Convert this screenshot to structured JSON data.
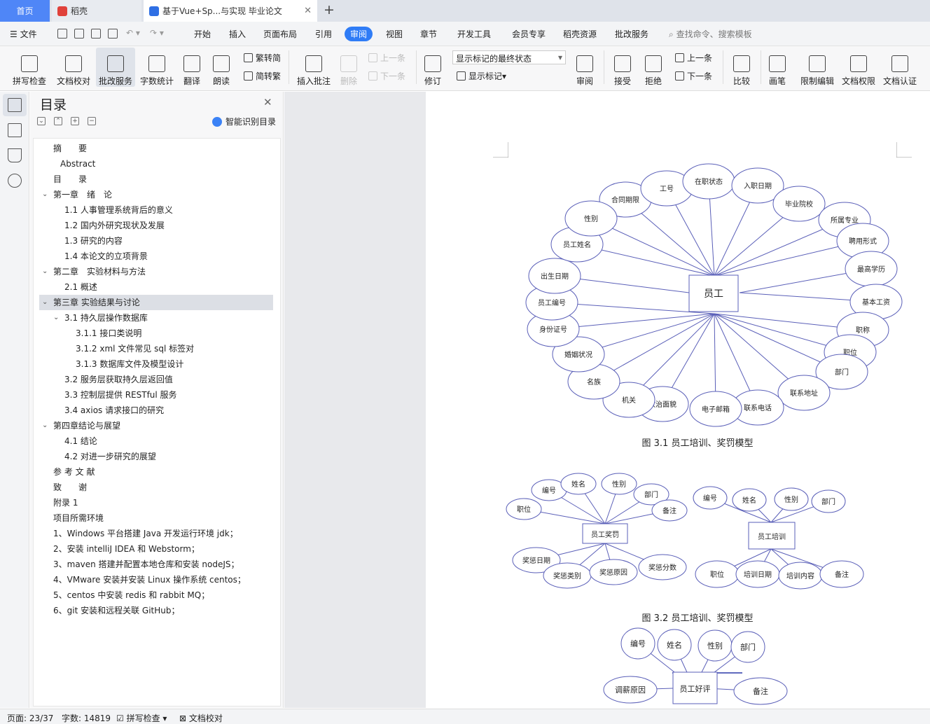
{
  "tabs": {
    "home": "首页",
    "daoke": "稻壳",
    "doc": "基于Vue+Sp...与实现 毕业论文"
  },
  "menu": {
    "file": "文件",
    "items": [
      "开始",
      "插入",
      "页面布局",
      "引用",
      "审阅",
      "视图",
      "章节",
      "开发工具",
      "会员专享",
      "稻壳资源",
      "批改服务"
    ],
    "active": "审阅",
    "search": "查找命令、搜索模板"
  },
  "ribbon": {
    "spell": "拼写检查",
    "proof": "文档校对",
    "review_service": "批改服务",
    "wordcount": "字数统计",
    "translate": "翻译",
    "read": "朗读",
    "to_simplified": "繁转简",
    "to_traditional": "简转繁",
    "insert_comment": "插入批注",
    "delete": "删除",
    "prev_comment": "上一条",
    "next_comment": "下一条",
    "track": "修订",
    "markup_select": "显示标记的最终状态",
    "show_markup": "显示标记",
    "review": "审阅",
    "accept": "接受",
    "reject": "拒绝",
    "prev_change": "上一条",
    "next_change": "下一条",
    "compare": "比较",
    "pen": "画笔",
    "restrict": "限制编辑",
    "perm": "文档权限",
    "cert": "文档认证"
  },
  "toc": {
    "title": "目录",
    "smart": "智能识别目录",
    "items": [
      {
        "text": "摘　　要",
        "level": 1
      },
      {
        "text": "Abstract",
        "level": 1
      },
      {
        "text": "目　　录",
        "level": 1
      },
      {
        "text": "第一章　绪　论",
        "level": 0
      },
      {
        "text": "1.1  人事管理系统背后的意义",
        "level": 2
      },
      {
        "text": "1.2  国内外研究现状及发展",
        "level": 2
      },
      {
        "text": "1.3  研究的内容",
        "level": 2
      },
      {
        "text": "1.4  本论文的立项背景",
        "level": 2
      },
      {
        "text": "第二章　实验材料与方法",
        "level": 0
      },
      {
        "text": "2.1  概述",
        "level": 2
      },
      {
        "text": "第三章  实验结果与讨论",
        "level": 0
      },
      {
        "text": "3.1  持久层操作数据库",
        "level": 2
      },
      {
        "text": "3.1.1  接口类说明",
        "level": 3
      },
      {
        "text": "3.1.2    xml 文件常见 sql 标签对",
        "level": 3
      },
      {
        "text": "3.1.3    数据库文件及模型设计",
        "level": 3
      },
      {
        "text": "3.2  服务层获取持久层返回值",
        "level": 2
      },
      {
        "text": "3.3  控制层提供 RESTful 服务",
        "level": 2
      },
      {
        "text": "3.4 axios 请求接口的研究",
        "level": 2
      },
      {
        "text": "第四章结论与展望",
        "level": 0
      },
      {
        "text": "4.1  结论",
        "level": 2
      },
      {
        "text": "4.2  对进一步研究的展望",
        "level": 2
      },
      {
        "text": "参 考 文 献",
        "level": 1
      },
      {
        "text": "致　　谢",
        "level": 1
      },
      {
        "text": "附录 1",
        "level": 1
      },
      {
        "text": "项目所需环境",
        "level": 1
      },
      {
        "text": "1、Windows 平台搭建 Java 开发运行环境 jdk；",
        "level": 1
      },
      {
        "text": "2、安装 intelliJ IDEA 和 Webstorm；",
        "level": 1
      },
      {
        "text": "3、maven 搭建并配置本地仓库和安装 nodeJS；",
        "level": 1
      },
      {
        "text": "4、VMware 安装并安装 Linux 操作系统 centos；",
        "level": 1
      },
      {
        "text": "5、centos 中安装 redis 和 rabbit MQ；",
        "level": 1
      },
      {
        "text": "6、git 安装和远程关联 GitHub；",
        "level": 1
      }
    ]
  },
  "doc": {
    "fig1": {
      "center": "员工",
      "caption": "图 3.1   员工培训、奖罚模型",
      "attrs": [
        "合同期限",
        "工号",
        "在职状态",
        "入职日期",
        "毕业院校",
        "所属专业",
        "聘用形式",
        "最高学历",
        "基本工资",
        "职称",
        "职位",
        "部门",
        "联系地址",
        "联系电话",
        "电子邮箱",
        "政治面貌",
        "机关",
        "名族",
        "婚姻状况",
        "身份证号",
        "员工编号",
        "出生日期",
        "员工姓名",
        "性别"
      ]
    },
    "fig2": {
      "caption": "图 3.2   员工培训、奖罚模型",
      "left": {
        "center": "员工奖罚",
        "attrs": [
          "编号",
          "姓名",
          "性别",
          "部门",
          "备注",
          "职位",
          "奖惩日期",
          "奖惩类别",
          "奖惩原因",
          "奖惩分数"
        ]
      },
      "right": {
        "center": "员工培训",
        "attrs": [
          "编号",
          "姓名",
          "性别",
          "部门",
          "职位",
          "培训日期",
          "培训内容",
          "备注"
        ]
      }
    },
    "fig3": {
      "center": "员工好评",
      "attrs": [
        "编号",
        "姓名",
        "性别",
        "部门",
        "调薪原因",
        "备注"
      ]
    }
  },
  "status": {
    "page": "页面: 23/37",
    "words": "字数: 14819",
    "spell": "拼写检查",
    "proof": "文档校对"
  }
}
